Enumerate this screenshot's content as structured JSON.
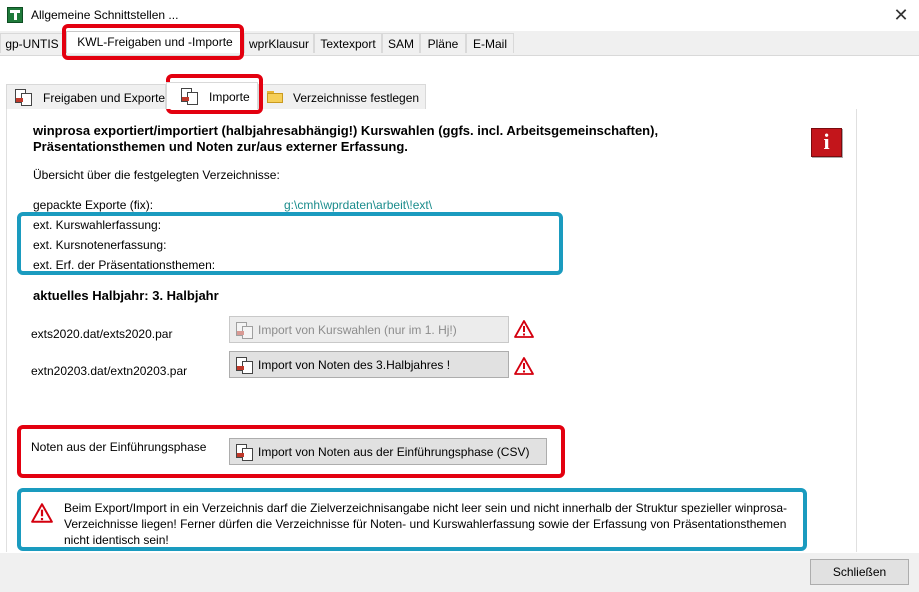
{
  "window": {
    "title": "Allgemeine Schnittstellen ...",
    "close_glyph": "✕"
  },
  "top_tabs": [
    {
      "label": "gp-UNTIS"
    },
    {
      "label": "KWL-Freigaben und -Importe",
      "active": true
    },
    {
      "label": "wprKlausur"
    },
    {
      "label": "Textexport"
    },
    {
      "label": "SAM"
    },
    {
      "label": "Pläne"
    },
    {
      "label": "E-Mail"
    }
  ],
  "inner_tabs": [
    {
      "label": "Freigaben und Exporte",
      "icon": "document-export-icon"
    },
    {
      "label": "Importe",
      "icon": "document-import-icon",
      "active": true
    },
    {
      "label": "Verzeichnisse festlegen",
      "icon": "folder-icon"
    }
  ],
  "content": {
    "heading_line1": "winprosa exportiert/importiert (halbjahresabhängig!) Kurswahlen (ggfs. incl. Arbeitsgemeinschaften),",
    "heading_line2": "Präsentationsthemen und Noten zur/aus externer Erfassung.",
    "overview_label": "Übersicht über die festgelegten Verzeichnisse:",
    "directories": [
      {
        "label": "gepackte Exporte (fix):",
        "value": "g:\\cmh\\wprdaten\\arbeit\\!ext\\"
      },
      {
        "label": "ext. Kurswahlerfassung:",
        "value": ""
      },
      {
        "label": "ext. Kursnotenerfassung:",
        "value": ""
      },
      {
        "label": "ext. Erf. der Präsentationsthemen:",
        "value": ""
      }
    ],
    "semester_label": "aktuelles Halbjahr: 3. Halbjahr",
    "imports": [
      {
        "file": "exts2020.dat/exts2020.par",
        "button": "Import von Kurswahlen  (nur im 1. Hj!)",
        "enabled": false
      },
      {
        "file": "extn20203.dat/extn20203.par",
        "button": "Import von Noten des 3.Halbjahres !",
        "enabled": true
      }
    ],
    "intro_phase": {
      "label": "Noten aus der Einführungsphase",
      "button": "Import von Noten aus der Einführungsphase (CSV)"
    },
    "notice": "Beim Export/Import in ein Verzeichnis darf die Zielverzeichnisangabe nicht leer sein und nicht innerhalb der Struktur spezieller winprosa-Verzeichnisse liegen! Ferner dürfen die Verzeichnisse für Noten- und Kurswahlerfassung sowie der Erfassung von Präsentationsthemen nicht identisch sein!"
  },
  "footer": {
    "close_button": "Schließen"
  },
  "colors": {
    "highlight_red": "#e3000f",
    "highlight_blue": "#1a9bbf",
    "path_text": "#1a8c8c",
    "info_button": "#c3151b"
  }
}
